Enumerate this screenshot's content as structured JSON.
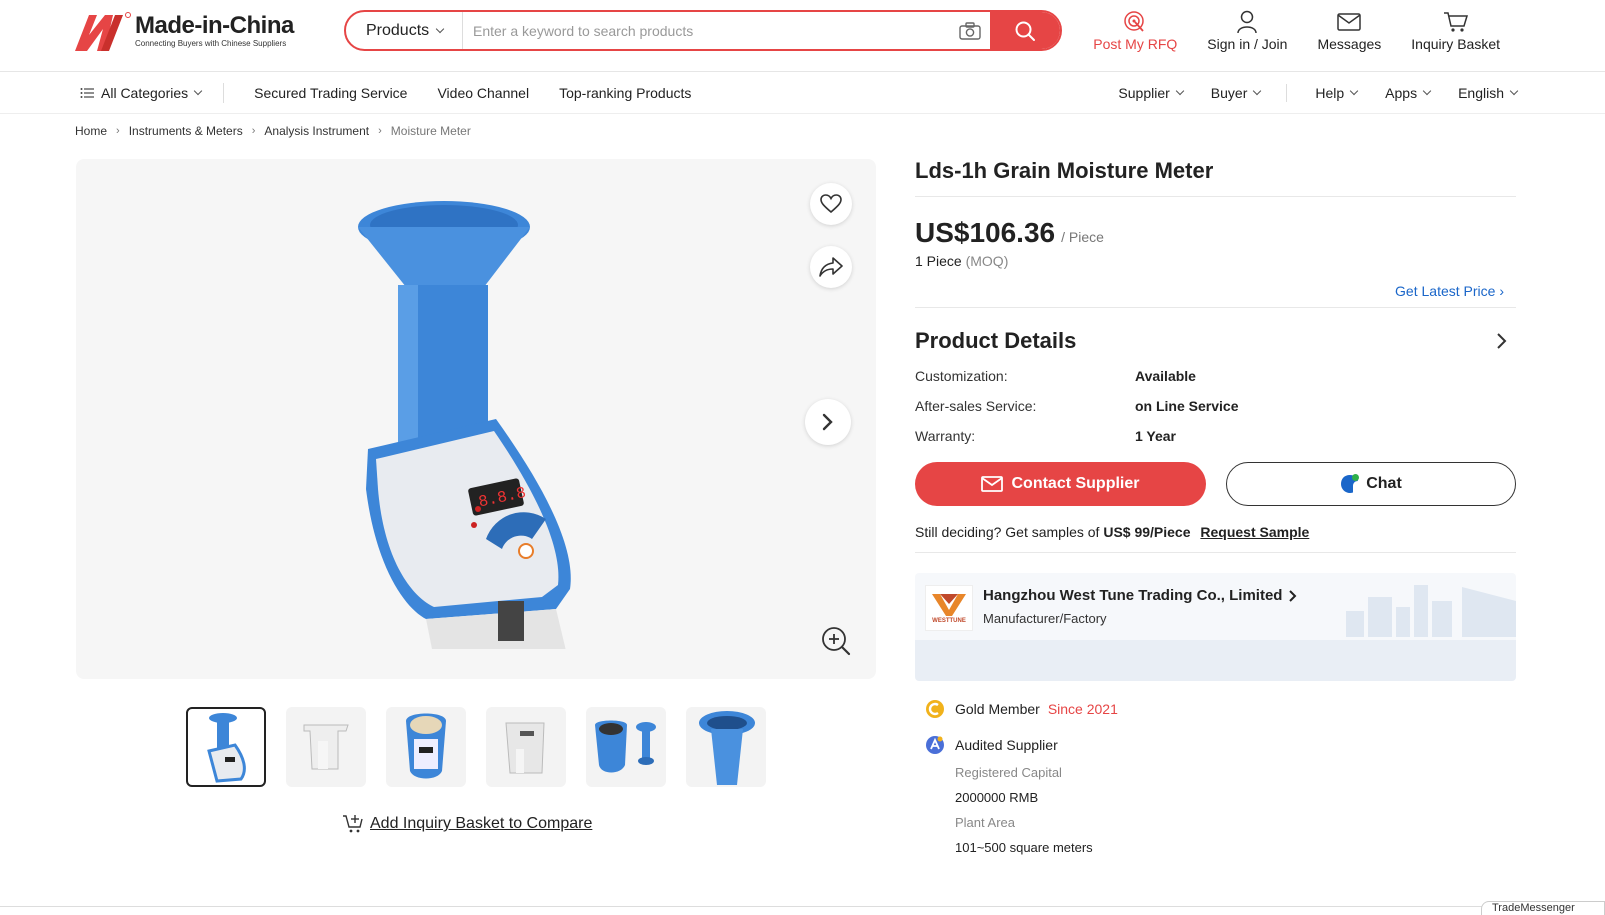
{
  "header": {
    "logo_title": "Made-in-China",
    "logo_sub": "Connecting Buyers with Chinese Suppliers",
    "search_category": "Products",
    "search_placeholder": "Enter a keyword to search products",
    "actions": {
      "rfq": "Post My RFQ",
      "signin": "Sign in / Join",
      "messages": "Messages",
      "basket": "Inquiry Basket"
    }
  },
  "nav": {
    "all_categories": "All Categories",
    "links": [
      "Secured Trading Service",
      "Video Channel",
      "Top-ranking Products"
    ],
    "right": [
      "Supplier",
      "Buyer",
      "Help",
      "Apps",
      "English"
    ]
  },
  "breadcrumb": [
    "Home",
    "Instruments & Meters",
    "Analysis Instrument",
    "Moisture Meter"
  ],
  "gallery": {
    "compare_label": "Add Inquiry Basket to Compare"
  },
  "product": {
    "title": "Lds-1h Grain Moisture Meter",
    "price": "US$106.36",
    "price_unit": "/ Piece",
    "moq_value": "1 Piece",
    "moq_label": "(MOQ)",
    "latest_price": "Get Latest Price",
    "details_title": "Product Details",
    "details": [
      {
        "k": "Customization:",
        "v": "Available"
      },
      {
        "k": "After-sales Service:",
        "v": "on Line Service"
      },
      {
        "k": "Warranty:",
        "v": "1 Year"
      }
    ],
    "contact_btn": "Contact Supplier",
    "chat_btn": "Chat",
    "sample_text": "Still deciding? Get samples of",
    "sample_price": "US$ 99/Piece",
    "sample_link": "Request Sample"
  },
  "supplier": {
    "name": "Hangzhou West Tune Trading Co., Limited",
    "type": "Manufacturer/Factory",
    "logo_text": "WESTTUNE",
    "gold": "Gold Member",
    "since": "Since 2021",
    "audited": "Audited Supplier",
    "capital_label": "Registered Capital",
    "capital_value": "2000000 RMB",
    "plant_label": "Plant Area",
    "plant_value": "101~500 square meters"
  },
  "float": {
    "trade": "TradeMessenger"
  },
  "colors": {
    "brand_red": "#e64545",
    "link_blue": "#1a66c9",
    "product_blue": "#3d86d8"
  }
}
